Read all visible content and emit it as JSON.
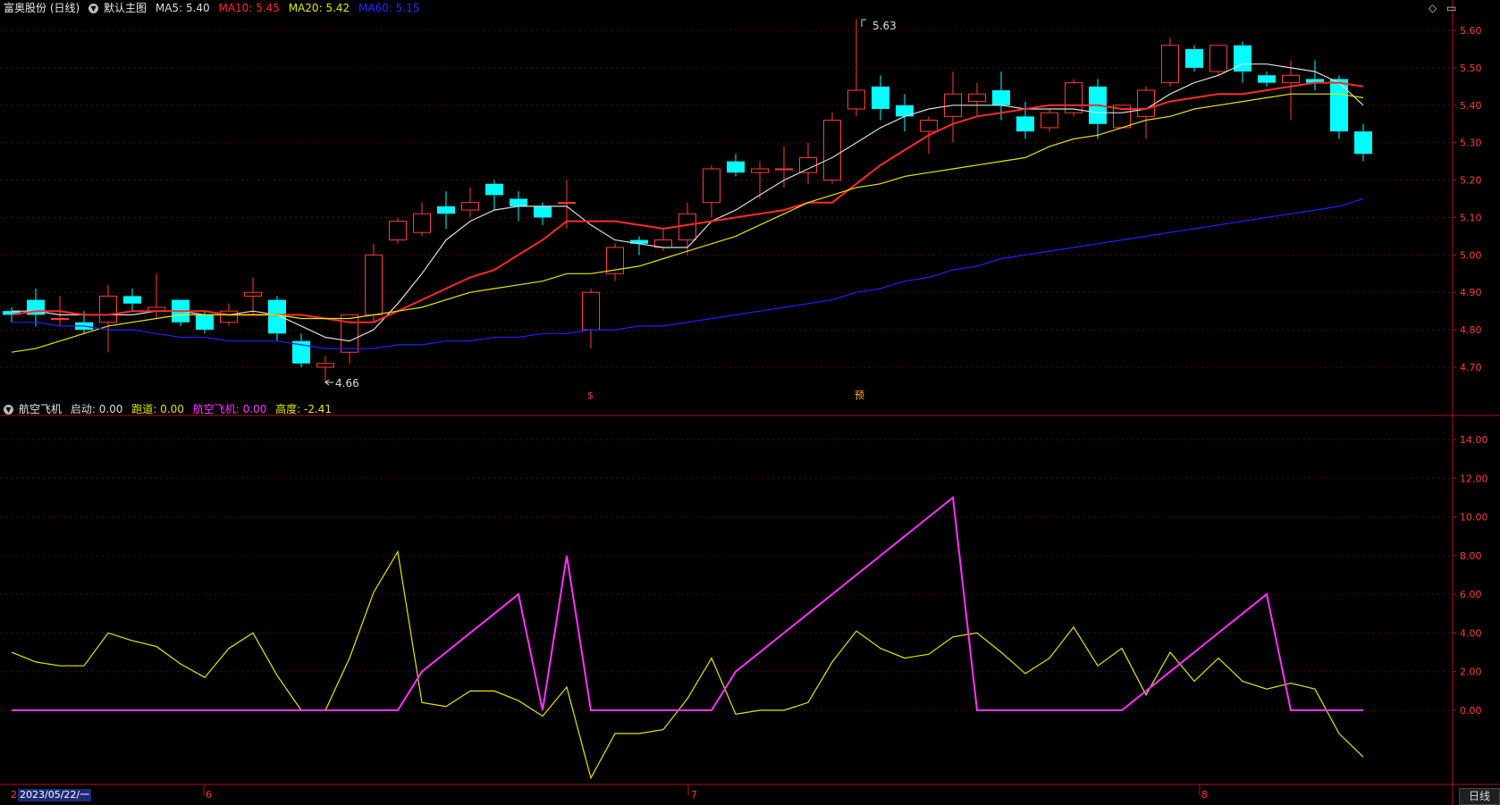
{
  "header": {
    "stock": "富奥股份 (日线)",
    "template": "默认主图",
    "ma5": {
      "label": "MA5:",
      "value": "5.40",
      "color": "#dcdcdc"
    },
    "ma10": {
      "label": "MA10:",
      "value": "5.45",
      "color": "#ff2a2a"
    },
    "ma20": {
      "label": "MA20:",
      "value": "5.42",
      "color": "#e6e600"
    },
    "ma60": {
      "label": "MA60:",
      "value": "5.15",
      "color": "#2a2aff"
    }
  },
  "sub_header": {
    "name": "航空飞机",
    "start": {
      "label": "启动:",
      "value": "0.00",
      "color": "#dcdcdc"
    },
    "runway": {
      "label": "跑道:",
      "value": "0.00",
      "color": "#e6e600"
    },
    "plane": {
      "label": "航空飞机:",
      "value": "0.00",
      "color": "#ff33ff"
    },
    "height": {
      "label": "高度:",
      "value": "-2.41",
      "color": "#e6e600"
    }
  },
  "markers": {
    "high": "5.63",
    "low": "4.66",
    "mark1": "$",
    "mark2": "预"
  },
  "time_axis": {
    "cursor_date": "2023/05/22/一",
    "months": [
      "6",
      "7",
      "8"
    ],
    "first_char": "2"
  },
  "daily_tab": "日线",
  "icons": [
    "diamond-icon",
    "window-icon",
    "collapse-icon"
  ],
  "chart_data": [
    {
      "type": "candlestick",
      "ylim": [
        4.62,
        5.64
      ],
      "yticks": [
        "5.60",
        "5.50",
        "5.40",
        "5.30",
        "5.20",
        "5.10",
        "5.00",
        "4.90",
        "4.80",
        "4.70"
      ],
      "up_color": "#ff3c3c",
      "down_color": "#00ffff",
      "candles": [
        [
          4.85,
          4.86,
          4.82,
          4.84
        ],
        [
          4.88,
          4.91,
          4.81,
          4.84
        ],
        [
          4.83,
          4.89,
          4.81,
          4.83
        ],
        [
          4.82,
          4.85,
          4.79,
          4.8
        ],
        [
          4.82,
          4.92,
          4.74,
          4.89
        ],
        [
          4.89,
          4.91,
          4.85,
          4.87
        ],
        [
          4.85,
          4.95,
          4.83,
          4.86
        ],
        [
          4.88,
          4.88,
          4.81,
          4.82
        ],
        [
          4.84,
          4.85,
          4.79,
          4.8
        ],
        [
          4.82,
          4.87,
          4.81,
          4.85
        ],
        [
          4.89,
          4.94,
          4.84,
          4.9
        ],
        [
          4.88,
          4.89,
          4.77,
          4.79
        ],
        [
          4.77,
          4.79,
          4.7,
          4.71
        ],
        [
          4.7,
          4.73,
          4.66,
          4.71
        ],
        [
          4.74,
          4.84,
          4.71,
          4.84
        ],
        [
          4.84,
          5.03,
          4.82,
          5.0
        ],
        [
          5.04,
          5.1,
          5.03,
          5.09
        ],
        [
          5.06,
          5.14,
          5.05,
          5.11
        ],
        [
          5.13,
          5.17,
          5.07,
          5.11
        ],
        [
          5.12,
          5.18,
          5.1,
          5.14
        ],
        [
          5.19,
          5.2,
          5.12,
          5.16
        ],
        [
          5.15,
          5.17,
          5.09,
          5.13
        ],
        [
          5.13,
          5.14,
          5.08,
          5.1
        ],
        [
          5.14,
          5.2,
          5.07,
          5.14
        ],
        [
          4.8,
          4.91,
          4.75,
          4.9
        ],
        [
          4.95,
          5.03,
          4.93,
          5.02
        ],
        [
          5.04,
          5.05,
          5.0,
          5.03
        ],
        [
          5.02,
          5.07,
          5.01,
          5.04
        ],
        [
          5.04,
          5.14,
          5.0,
          5.11
        ],
        [
          5.14,
          5.24,
          5.1,
          5.23
        ],
        [
          5.25,
          5.27,
          5.21,
          5.22
        ],
        [
          5.22,
          5.25,
          5.15,
          5.23
        ],
        [
          5.23,
          5.29,
          5.18,
          5.23
        ],
        [
          5.22,
          5.3,
          5.19,
          5.26
        ],
        [
          5.2,
          5.38,
          5.19,
          5.36
        ],
        [
          5.39,
          5.63,
          5.37,
          5.44
        ],
        [
          5.45,
          5.48,
          5.36,
          5.39
        ],
        [
          5.4,
          5.43,
          5.33,
          5.37
        ],
        [
          5.33,
          5.37,
          5.27,
          5.36
        ],
        [
          5.37,
          5.49,
          5.3,
          5.43
        ],
        [
          5.41,
          5.46,
          5.37,
          5.43
        ],
        [
          5.44,
          5.49,
          5.36,
          5.4
        ],
        [
          5.37,
          5.41,
          5.31,
          5.33
        ],
        [
          5.34,
          5.39,
          5.33,
          5.38
        ],
        [
          5.38,
          5.47,
          5.37,
          5.46
        ],
        [
          5.45,
          5.47,
          5.31,
          5.35
        ],
        [
          5.34,
          5.4,
          5.34,
          5.4
        ],
        [
          5.37,
          5.45,
          5.31,
          5.44
        ],
        [
          5.46,
          5.58,
          5.45,
          5.56
        ],
        [
          5.55,
          5.56,
          5.49,
          5.5
        ],
        [
          5.49,
          5.56,
          5.48,
          5.56
        ],
        [
          5.56,
          5.57,
          5.46,
          5.49
        ],
        [
          5.48,
          5.49,
          5.45,
          5.46
        ],
        [
          5.46,
          5.52,
          5.36,
          5.48
        ],
        [
          5.47,
          5.52,
          5.44,
          5.46
        ],
        [
          5.47,
          5.48,
          5.31,
          5.33
        ],
        [
          5.33,
          5.35,
          5.25,
          5.27
        ]
      ],
      "series": [
        {
          "name": "MA5",
          "color": "#dcdcdc",
          "values": [
            4.85,
            4.85,
            4.84,
            4.84,
            4.84,
            4.84,
            4.85,
            4.85,
            4.84,
            4.84,
            4.85,
            4.84,
            4.81,
            4.78,
            4.77,
            4.8,
            4.87,
            4.95,
            5.04,
            5.09,
            5.12,
            5.13,
            5.13,
            5.13,
            5.08,
            5.04,
            5.03,
            5.02,
            5.02,
            5.09,
            5.12,
            5.16,
            5.2,
            5.23,
            5.26,
            5.3,
            5.34,
            5.37,
            5.39,
            5.4,
            5.4,
            5.4,
            5.39,
            5.39,
            5.39,
            5.38,
            5.38,
            5.39,
            5.43,
            5.46,
            5.48,
            5.51,
            5.51,
            5.5,
            5.49,
            5.46,
            5.4
          ]
        },
        {
          "name": "MA10",
          "color": "#ff2a2a",
          "values": [
            4.84,
            4.85,
            4.85,
            4.84,
            4.84,
            4.85,
            4.85,
            4.85,
            4.85,
            4.84,
            4.84,
            4.84,
            4.84,
            4.83,
            4.82,
            4.82,
            4.85,
            4.88,
            4.91,
            4.94,
            4.96,
            5.0,
            5.04,
            5.09,
            5.09,
            5.09,
            5.08,
            5.07,
            5.08,
            5.09,
            5.1,
            5.11,
            5.12,
            5.14,
            5.14,
            5.19,
            5.24,
            5.28,
            5.32,
            5.35,
            5.37,
            5.38,
            5.39,
            5.4,
            5.4,
            5.4,
            5.39,
            5.39,
            5.41,
            5.42,
            5.43,
            5.43,
            5.44,
            5.45,
            5.46,
            5.46,
            5.45
          ]
        },
        {
          "name": "MA20",
          "color": "#e6e600",
          "values": [
            4.74,
            4.75,
            4.77,
            4.79,
            4.81,
            4.82,
            4.83,
            4.84,
            4.84,
            4.84,
            4.84,
            4.84,
            4.83,
            4.83,
            4.83,
            4.84,
            4.85,
            4.86,
            4.88,
            4.9,
            4.91,
            4.92,
            4.93,
            4.95,
            4.95,
            4.96,
            4.97,
            4.99,
            5.01,
            5.03,
            5.05,
            5.08,
            5.11,
            5.14,
            5.16,
            5.18,
            5.19,
            5.21,
            5.22,
            5.23,
            5.24,
            5.25,
            5.26,
            5.29,
            5.31,
            5.32,
            5.34,
            5.36,
            5.37,
            5.39,
            5.4,
            5.41,
            5.42,
            5.43,
            5.43,
            5.43,
            5.42
          ]
        },
        {
          "name": "MA60",
          "color": "#2020ff",
          "values": [
            4.82,
            4.82,
            4.81,
            4.81,
            4.8,
            4.8,
            4.79,
            4.78,
            4.78,
            4.77,
            4.77,
            4.77,
            4.76,
            4.75,
            4.75,
            4.75,
            4.76,
            4.76,
            4.77,
            4.77,
            4.78,
            4.78,
            4.79,
            4.79,
            4.8,
            4.8,
            4.81,
            4.81,
            4.82,
            4.83,
            4.84,
            4.85,
            4.86,
            4.87,
            4.88,
            4.9,
            4.91,
            4.93,
            4.94,
            4.96,
            4.97,
            4.99,
            5.0,
            5.01,
            5.02,
            5.03,
            5.04,
            5.05,
            5.06,
            5.07,
            5.08,
            5.09,
            5.1,
            5.11,
            5.12,
            5.13,
            5.15
          ]
        }
      ]
    },
    {
      "type": "line",
      "ylim": [
        -3.8,
        15.8
      ],
      "yticks": [
        "14.00",
        "12.00",
        "10.00",
        "8.00",
        "6.00",
        "4.00",
        "2.00",
        "0.00"
      ],
      "series": [
        {
          "name": "跑道",
          "color": "#e6e600",
          "values": [
            3.0,
            2.5,
            2.3,
            2.3,
            4.0,
            3.6,
            3.3,
            2.4,
            1.7,
            3.2,
            4.0,
            1.8,
            0.0,
            0.0,
            2.7,
            6.1,
            8.2,
            0.4,
            0.2,
            1.0,
            1.0,
            0.5,
            -0.3,
            1.2,
            -3.5,
            -1.2,
            -1.2,
            -1.0,
            0.6,
            2.7,
            -0.2,
            0.0,
            0.0,
            0.4,
            2.5,
            4.1,
            3.2,
            2.7,
            2.9,
            3.8,
            4.0,
            3.0,
            1.9,
            2.7,
            4.3,
            2.3,
            3.2,
            0.8,
            3.0,
            1.5,
            2.7,
            1.5,
            1.1,
            1.4,
            1.1,
            -1.2,
            -2.41
          ]
        },
        {
          "name": "航空飞机",
          "color": "#ff33ff",
          "values": [
            0,
            0,
            0,
            0,
            0,
            0,
            0,
            0,
            0,
            0,
            0,
            0,
            0,
            0,
            0,
            0,
            0,
            2.0,
            3.0,
            4.0,
            5.0,
            6.0,
            0.0,
            8.0,
            0,
            0,
            0,
            0,
            0,
            0,
            2.0,
            3.0,
            4.0,
            5.0,
            6.0,
            7.0,
            8.0,
            9.0,
            10.0,
            11.0,
            0,
            0,
            0,
            0,
            0,
            0,
            0,
            1.0,
            2.0,
            3.0,
            4.0,
            5.0,
            6.0,
            0,
            0,
            0,
            0
          ]
        }
      ]
    }
  ]
}
